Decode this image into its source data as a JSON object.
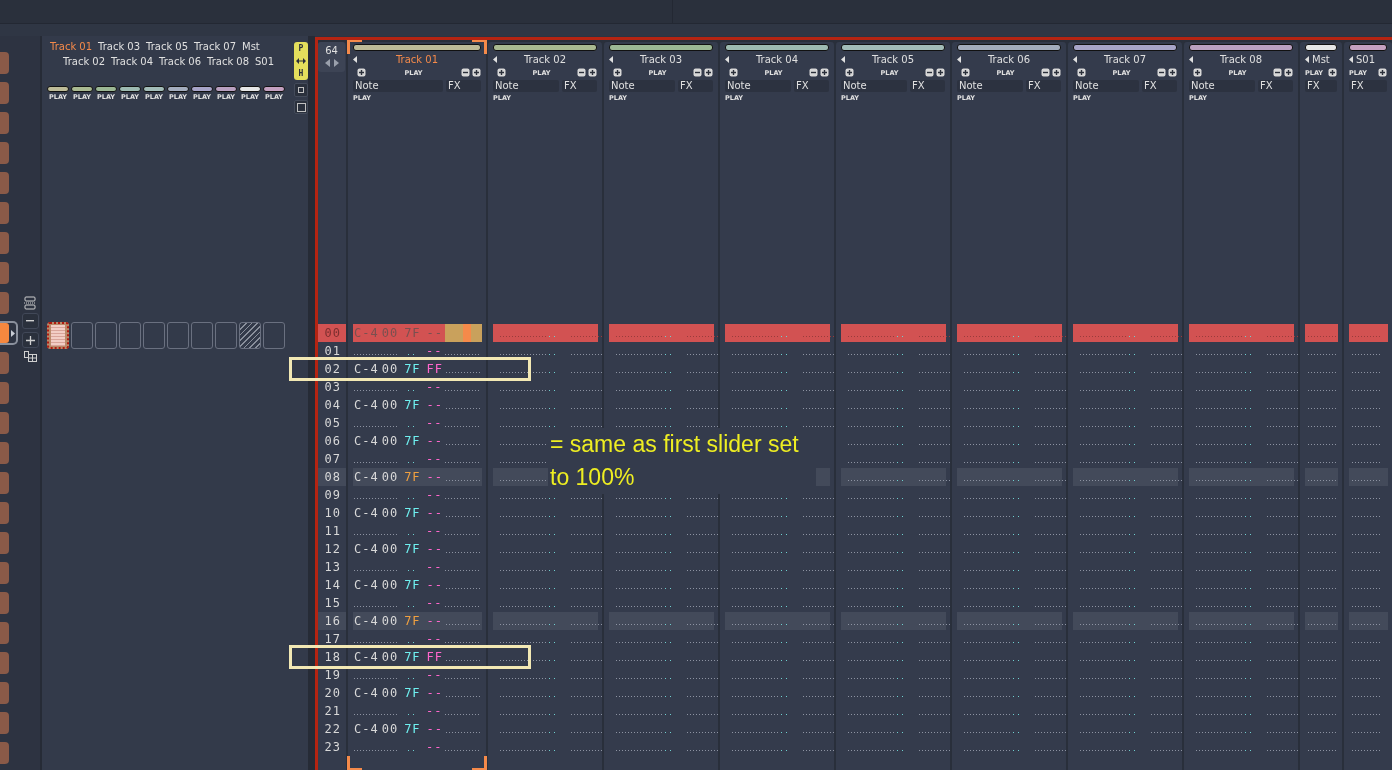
{
  "sequence": [
    {
      "selected": false
    },
    {
      "selected": false
    },
    {
      "selected": false
    },
    {
      "selected": false
    },
    {
      "selected": false
    },
    {
      "selected": false
    },
    {
      "selected": false
    },
    {
      "selected": false
    },
    {
      "selected": false
    },
    {
      "selected": true
    },
    {
      "selected": false
    },
    {
      "selected": false
    },
    {
      "selected": false
    },
    {
      "selected": false
    },
    {
      "selected": false
    },
    {
      "selected": false
    },
    {
      "selected": false
    },
    {
      "selected": false
    },
    {
      "selected": false
    },
    {
      "selected": false
    },
    {
      "selected": false
    },
    {
      "selected": false
    },
    {
      "selected": false
    },
    {
      "selected": false
    }
  ],
  "overview": {
    "labels": [
      {
        "text": "Track 01",
        "selected": true
      },
      {
        "text": "Track 02",
        "selected": false
      },
      {
        "text": "Track 03",
        "selected": false
      },
      {
        "text": "Track 04",
        "selected": false
      },
      {
        "text": "Track 05",
        "selected": false
      },
      {
        "text": "Track 06",
        "selected": false
      },
      {
        "text": "Track 07",
        "selected": false
      },
      {
        "text": "Track 08",
        "selected": false
      },
      {
        "text": "Mst",
        "selected": false
      },
      {
        "text": "S01",
        "selected": false
      }
    ],
    "play_buttons": [
      {
        "label": "PLAY",
        "color": "#bdbb98"
      },
      {
        "label": "PLAY",
        "color": "#a9b991"
      },
      {
        "label": "PLAY",
        "color": "#9bb794"
      },
      {
        "label": "PLAY",
        "color": "#9dbab1"
      },
      {
        "label": "PLAY",
        "color": "#a2bcb8"
      },
      {
        "label": "PLAY",
        "color": "#a3acbd"
      },
      {
        "label": "PLAY",
        "color": "#a7a4c8"
      },
      {
        "label": "PLAY",
        "color": "#b9a0c0"
      },
      {
        "label": "PLAY",
        "color": "#e6e6e6"
      },
      {
        "label": "PLAY",
        "color": "#c4a0c0"
      }
    ],
    "slots": [
      {
        "kind": "filled",
        "selected": true
      },
      {
        "kind": "empty",
        "selected": false
      },
      {
        "kind": "empty",
        "selected": false
      },
      {
        "kind": "empty",
        "selected": false
      },
      {
        "kind": "empty",
        "selected": false
      },
      {
        "kind": "empty",
        "selected": false
      },
      {
        "kind": "empty",
        "selected": false
      },
      {
        "kind": "empty",
        "selected": false
      },
      {
        "kind": "muted",
        "selected": false
      },
      {
        "kind": "empty",
        "selected": false
      }
    ],
    "toggle": {
      "top": "P",
      "bottom": "H",
      "on": true
    }
  },
  "pattern": {
    "line_count": "64",
    "tracks": [
      {
        "name": "Track 01",
        "kind": "track",
        "color": "#bdbb98",
        "selected": true,
        "play": "PLAY",
        "columns": [
          "Note",
          "FX"
        ],
        "mode": "PLAY",
        "cells": [
          {
            "note": "C-4",
            "instrument": "00",
            "volume": "7F",
            "fx": "--"
          },
          {
            "fx": "--"
          },
          {
            "note": "C-4",
            "instrument": "00",
            "volume": "7F",
            "fx": "FF"
          },
          {
            "fx": "--"
          },
          {
            "note": "C-4",
            "instrument": "00",
            "volume": "7F",
            "fx": "--"
          },
          {
            "fx": "--"
          },
          {
            "note": "C-4",
            "instrument": "00",
            "volume": "7F",
            "fx": "--"
          },
          {
            "fx": "--"
          },
          {
            "note": "C-4",
            "instrument": "00",
            "volume": "7F",
            "fx": "--"
          },
          {
            "fx": "--"
          },
          {
            "note": "C-4",
            "instrument": "00",
            "volume": "7F",
            "fx": "--"
          },
          {
            "fx": "--"
          },
          {
            "note": "C-4",
            "instrument": "00",
            "volume": "7F",
            "fx": "--"
          },
          {
            "fx": "--"
          },
          {
            "note": "C-4",
            "instrument": "00",
            "volume": "7F",
            "fx": "--"
          },
          {
            "fx": "--"
          },
          {
            "note": "C-4",
            "instrument": "00",
            "volume": "7F",
            "fx": "--"
          },
          {
            "fx": "--"
          },
          {
            "note": "C-4",
            "instrument": "00",
            "volume": "7F",
            "fx": "FF"
          },
          {
            "fx": "--"
          },
          {
            "note": "C-4",
            "instrument": "00",
            "volume": "7F",
            "fx": "--"
          },
          {
            "fx": "--"
          },
          {
            "note": "C-4",
            "instrument": "00",
            "volume": "7F",
            "fx": "--"
          },
          {
            "fx": "--"
          }
        ]
      },
      {
        "name": "Track 02",
        "kind": "track",
        "color": "#a9b991",
        "selected": false,
        "play": "PLAY",
        "columns": [
          "Note",
          "FX"
        ],
        "mode": "PLAY"
      },
      {
        "name": "Track 03",
        "kind": "track",
        "color": "#9bb794",
        "selected": false,
        "play": "PLAY",
        "columns": [
          "Note",
          "FX"
        ],
        "mode": "PLAY"
      },
      {
        "name": "Track 04",
        "kind": "track",
        "color": "#9dbab1",
        "selected": false,
        "play": "PLAY",
        "columns": [
          "Note",
          "FX"
        ],
        "mode": "PLAY"
      },
      {
        "name": "Track 05",
        "kind": "track",
        "color": "#a2bcb8",
        "selected": false,
        "play": "PLAY",
        "columns": [
          "Note",
          "FX"
        ],
        "mode": "PLAY"
      },
      {
        "name": "Track 06",
        "kind": "track",
        "color": "#a3acbd",
        "selected": false,
        "play": "PLAY",
        "columns": [
          "Note",
          "FX"
        ],
        "mode": "PLAY"
      },
      {
        "name": "Track 07",
        "kind": "track",
        "color": "#a7a4c8",
        "selected": false,
        "play": "PLAY",
        "columns": [
          "Note",
          "FX"
        ],
        "mode": "PLAY"
      },
      {
        "name": "Track 08",
        "kind": "track",
        "color": "#b9a0c0",
        "selected": false,
        "play": "PLAY",
        "columns": [
          "Note",
          "FX"
        ],
        "mode": "PLAY"
      },
      {
        "name": "Mst",
        "kind": "master",
        "color": "#e6e6e6",
        "selected": false,
        "play": "PLAY",
        "columns": [
          "FX"
        ]
      },
      {
        "name": "S01",
        "kind": "send",
        "color": "#c4a0c0",
        "selected": false,
        "play": "PLAY",
        "columns": [
          "FX"
        ]
      }
    ],
    "rows": [
      {
        "line": "00",
        "kind": "cursor",
        "boxed": false
      },
      {
        "line": "01",
        "kind": "normal",
        "boxed": false
      },
      {
        "line": "02",
        "kind": "normal",
        "boxed": true
      },
      {
        "line": "03",
        "kind": "normal",
        "boxed": false
      },
      {
        "line": "04",
        "kind": "normal",
        "boxed": false
      },
      {
        "line": "05",
        "kind": "normal",
        "boxed": false
      },
      {
        "line": "06",
        "kind": "normal",
        "boxed": false
      },
      {
        "line": "07",
        "kind": "normal",
        "boxed": false
      },
      {
        "line": "08",
        "kind": "beat",
        "boxed": false
      },
      {
        "line": "09",
        "kind": "normal",
        "boxed": false
      },
      {
        "line": "10",
        "kind": "normal",
        "boxed": false
      },
      {
        "line": "11",
        "kind": "normal",
        "boxed": false
      },
      {
        "line": "12",
        "kind": "normal",
        "boxed": false
      },
      {
        "line": "13",
        "kind": "normal",
        "boxed": false
      },
      {
        "line": "14",
        "kind": "normal",
        "boxed": false
      },
      {
        "line": "15",
        "kind": "normal",
        "boxed": false
      },
      {
        "line": "16",
        "kind": "beat",
        "boxed": false
      },
      {
        "line": "17",
        "kind": "normal",
        "boxed": false
      },
      {
        "line": "18",
        "kind": "normal",
        "boxed": true
      },
      {
        "line": "19",
        "kind": "normal",
        "boxed": false
      },
      {
        "line": "20",
        "kind": "normal",
        "boxed": false
      },
      {
        "line": "21",
        "kind": "normal",
        "boxed": false
      },
      {
        "line": "22",
        "kind": "normal",
        "boxed": false
      },
      {
        "line": "23",
        "kind": "normal",
        "boxed": false
      }
    ]
  },
  "annotation": {
    "text": "= same as first slider set to 100%"
  }
}
